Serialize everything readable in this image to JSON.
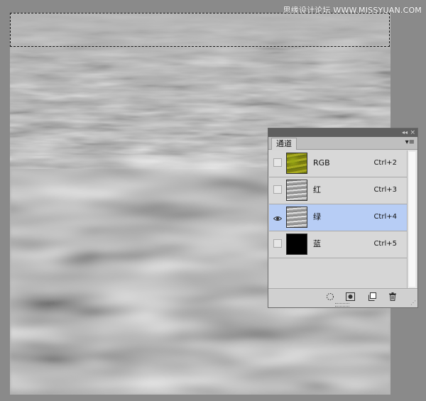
{
  "watermark": "思缘设计论坛 WWW.MISSYUAN.COM",
  "panel": {
    "tab_label": "通道",
    "collapse_glyph": "◂◂",
    "close_glyph": "×",
    "menu_glyph": "▾≡",
    "channels": [
      {
        "name": "RGB",
        "shortcut": "Ctrl+2",
        "visible": false,
        "selected": false,
        "thumb": "rgb"
      },
      {
        "name": "红",
        "shortcut": "Ctrl+3",
        "visible": false,
        "selected": false,
        "thumb": "gray"
      },
      {
        "name": "绿",
        "shortcut": "Ctrl+4",
        "visible": true,
        "selected": true,
        "thumb": "gray"
      },
      {
        "name": "蓝",
        "shortcut": "Ctrl+5",
        "visible": false,
        "selected": false,
        "thumb": "black"
      }
    ],
    "footer_icons": [
      "dotted-circle-icon",
      "mask-icon",
      "new-channel-icon",
      "trash-icon"
    ],
    "colors": {
      "selected_row": "#b7cdf5",
      "panel_bg": "#d6d6d6"
    }
  }
}
